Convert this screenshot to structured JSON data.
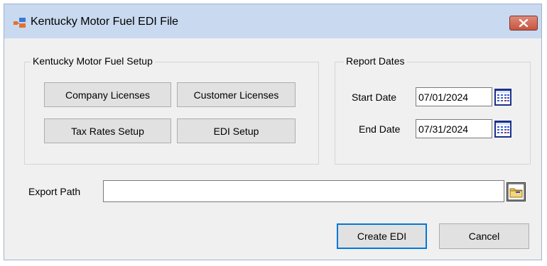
{
  "window": {
    "title": "Kentucky Motor Fuel EDI File",
    "colors": {
      "titlebar": "#c9d9ef",
      "close": "#c8553f",
      "face": "#f0f0f0",
      "accent": "#0078d7"
    }
  },
  "setup_group": {
    "legend": "Kentucky Motor Fuel  Setup",
    "buttons": {
      "company_licenses": "Company Licenses",
      "customer_licenses": "Customer Licenses",
      "tax_rates_setup": "Tax Rates Setup",
      "edi_setup": "EDI Setup"
    }
  },
  "report_dates": {
    "legend": "Report Dates",
    "start_label": "Start Date",
    "start_value": "07/01/2024",
    "end_label": "End Date",
    "end_value": "07/31/2024"
  },
  "export": {
    "label": "Export Path",
    "value": ""
  },
  "actions": {
    "create": "Create EDI",
    "cancel": "Cancel"
  },
  "icons": [
    "app-icon",
    "close-icon",
    "calendar-icon",
    "folder-icon"
  ]
}
